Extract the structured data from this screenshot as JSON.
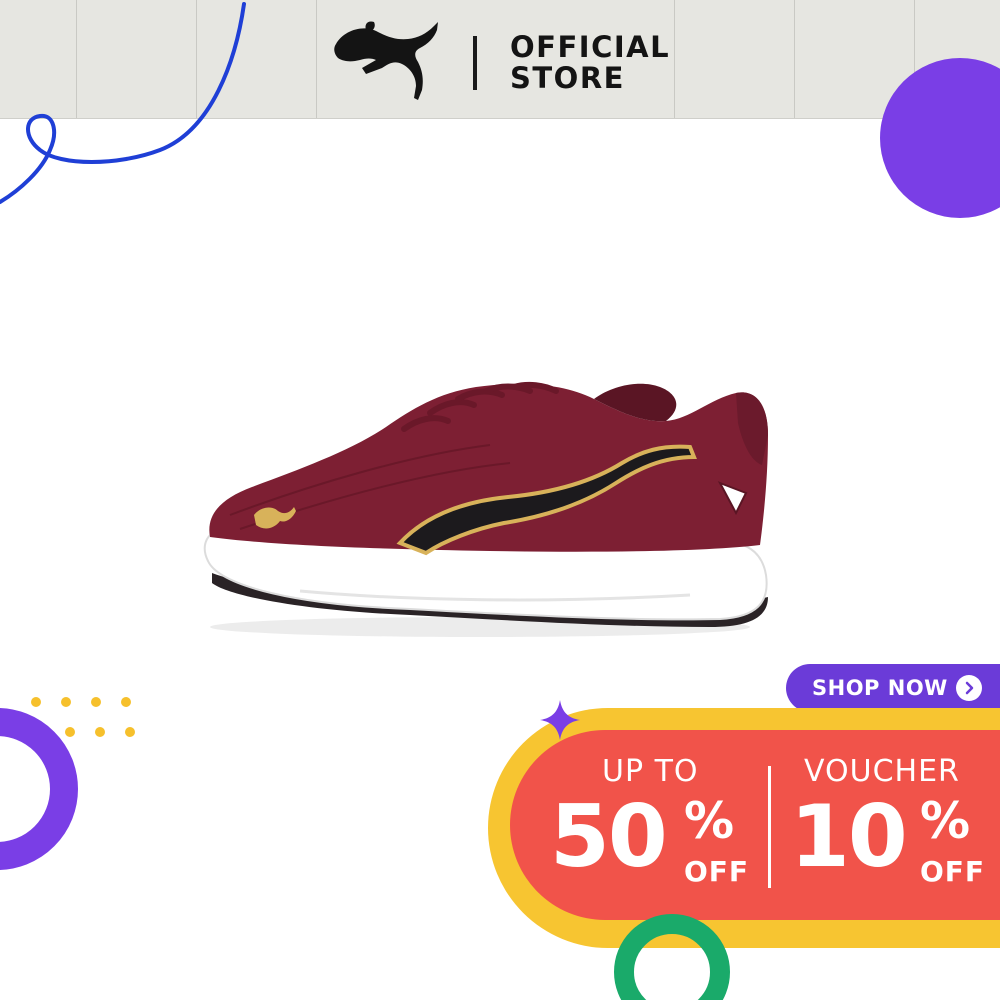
{
  "header": {
    "brand_name": "PUMA",
    "store_line1": "OFFICIAL",
    "store_line2": "STORE"
  },
  "product": {
    "icon": "running-shoe-image",
    "colors": {
      "upper": "#7d1f33",
      "stripe": "#1c1a1d",
      "trim": "#d8b25a",
      "sole": "#ffffff"
    }
  },
  "promo": {
    "discount": {
      "label": "UP TO",
      "value": "50",
      "unit": "%",
      "suffix": "OFF"
    },
    "voucher": {
      "label": "VOUCHER",
      "value": "10",
      "unit": "%",
      "suffix": "OFF"
    }
  },
  "cta": {
    "label": "SHOP NOW",
    "icon": "chevron-right-icon"
  },
  "colors": {
    "header_bg": "#e6e6e1",
    "accent_purple": "#7a3ee6",
    "promo_red": "#f1534a",
    "promo_yellow": "#f7c531",
    "deco_blue": "#1f3fd6",
    "deco_green": "#1aaa6a"
  }
}
